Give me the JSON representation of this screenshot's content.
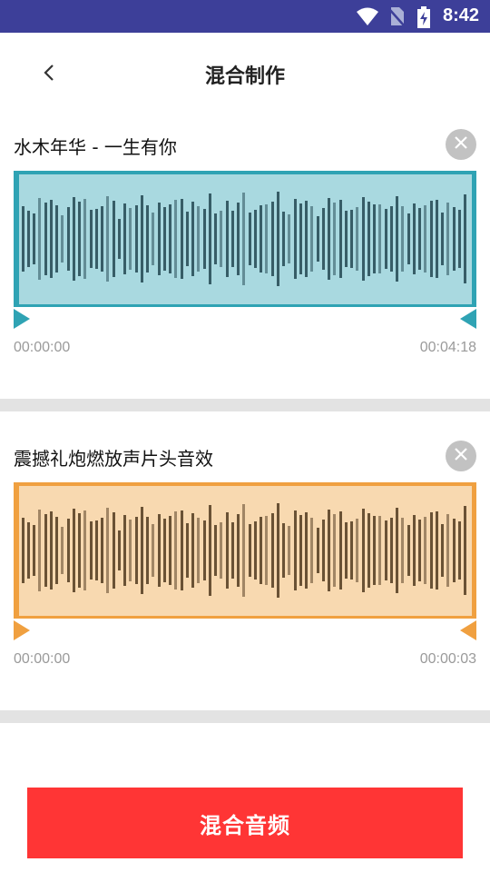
{
  "status_bar": {
    "time": "8:42",
    "icons": [
      "wifi-icon",
      "no-sim-icon",
      "battery-charging-icon"
    ]
  },
  "header": {
    "title": "混合制作",
    "back_icon": "chevron-left-icon"
  },
  "tracks": [
    {
      "title": "水木年华 - 一生有你",
      "start_time": "00:00:00",
      "end_time": "00:04:18",
      "colors": {
        "border": "#2fa3b4",
        "fill": "#a9d9e0",
        "bars": "#2a4f5a"
      }
    },
    {
      "title": "震撼礼炮燃放声片头音效",
      "start_time": "00:00:00",
      "end_time": "00:00:03",
      "colors": {
        "border": "#f0a040",
        "fill": "#f8d9b0",
        "bars": "#5a4228"
      }
    }
  ],
  "actions": {
    "mix_label": "混合音频",
    "mix_color": "#ff3535"
  }
}
